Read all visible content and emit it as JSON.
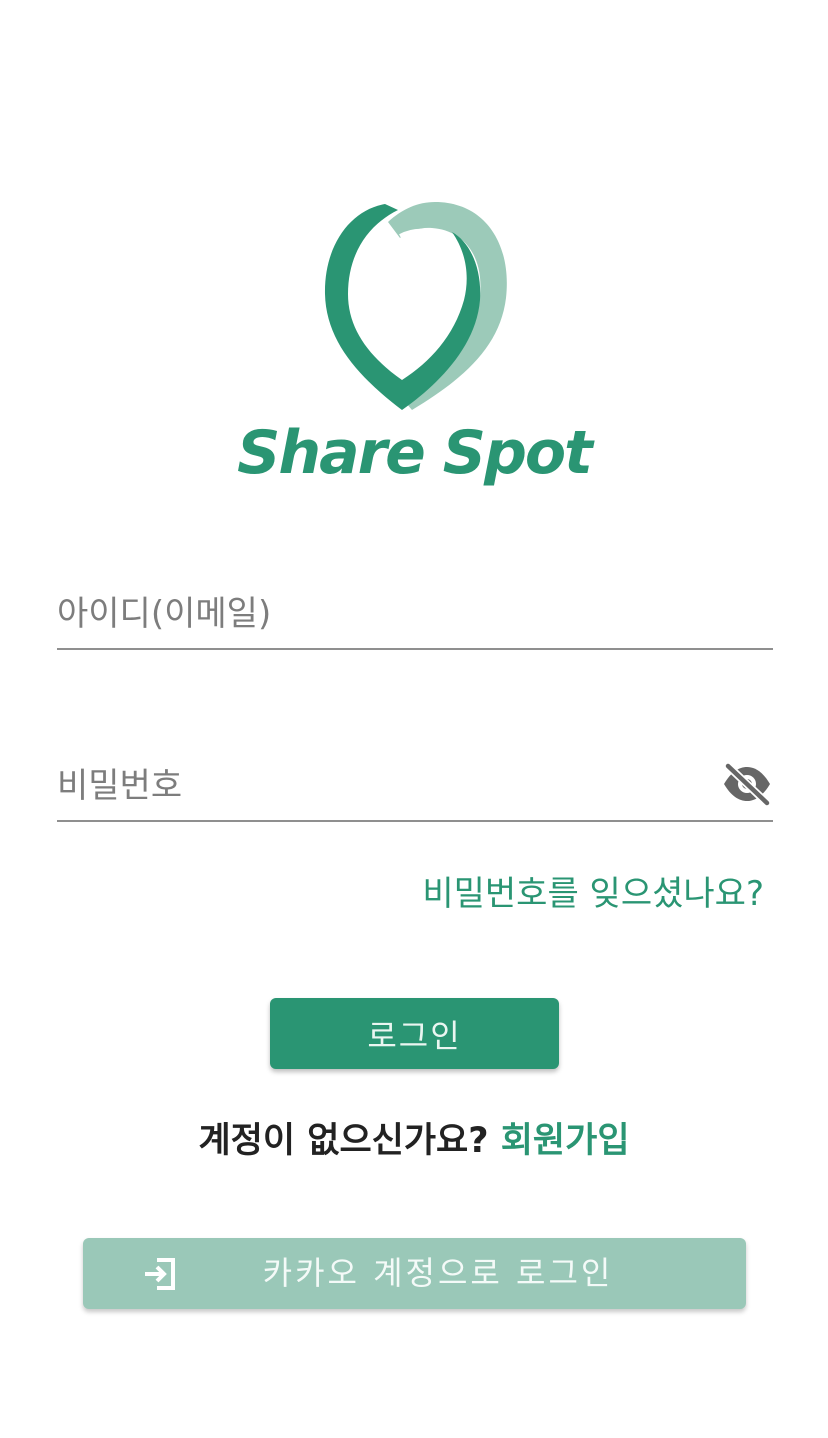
{
  "app": {
    "brand_name": "Share Spot",
    "logo_icon": "location-pin-logo"
  },
  "login_form": {
    "id_placeholder": "아이디(이메일)",
    "password_placeholder": "비밀번호",
    "visibility_icon": "eye-off-icon",
    "forgot_password_label": "비밀번호를 잊으셨나요?",
    "login_button_label": "로그인"
  },
  "signup": {
    "prompt": "계정이 없으신가요?",
    "link_label": "회원가입"
  },
  "kakao": {
    "icon": "login-icon",
    "button_label": "카카오 계정으로 로그인"
  },
  "colors": {
    "primary": "#2a9573",
    "primary_light": "#9ac8b8",
    "text": "#222222",
    "placeholder": "#7d7d7d"
  }
}
